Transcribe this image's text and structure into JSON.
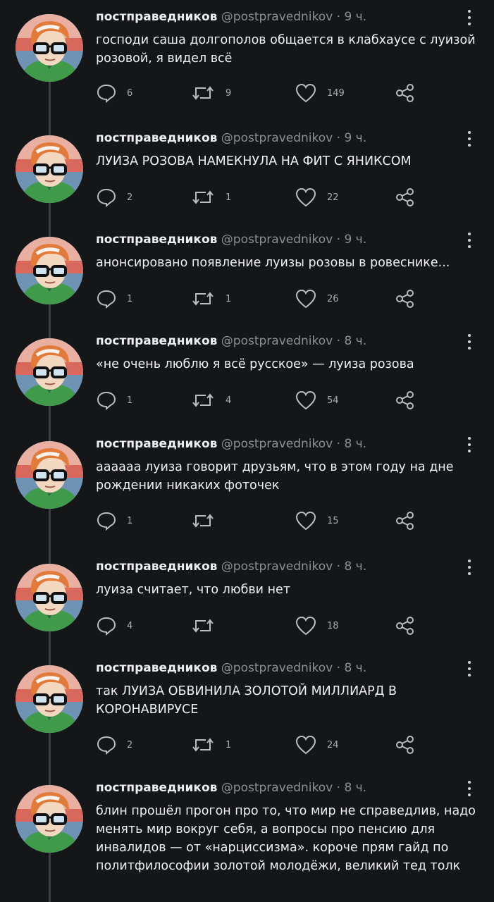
{
  "tweets": [
    {
      "name": "постправедников",
      "handle": "@postpravednikov",
      "time": "9 ч.",
      "text": "господи саша долгополов общается в клабхаусе с луизой розовой, я видел всё",
      "replies": "6",
      "retweets": "9",
      "likes": "149"
    },
    {
      "name": "постправедников",
      "handle": "@postpravednikov",
      "time": "9 ч.",
      "text": "ЛУИЗА РОЗОВА НАМЕКНУЛА НА ФИТ С ЯНИКСОМ",
      "replies": "2",
      "retweets": "1",
      "likes": "22"
    },
    {
      "name": "постправедников",
      "handle": "@postpravednikov",
      "time": "9 ч.",
      "text": "анонсировано появление луизы розовы в ровеснике...",
      "replies": "1",
      "retweets": "1",
      "likes": "26"
    },
    {
      "name": "постправедников",
      "handle": "@postpravednikov",
      "time": "8 ч.",
      "text": "«не очень люблю я всё русское» — луиза розова",
      "replies": "1",
      "retweets": "4",
      "likes": "54"
    },
    {
      "name": "постправедников",
      "handle": "@postpravednikov",
      "time": "8 ч.",
      "text": "аааааа луиза говорит друзьям, что в этом году на дне рождении никаких фоточек",
      "replies": "1",
      "retweets": "",
      "likes": "15"
    },
    {
      "name": "постправедников",
      "handle": "@postpravednikov",
      "time": "8 ч.",
      "text": "луиза считает, что любви нет",
      "replies": "4",
      "retweets": "",
      "likes": "18"
    },
    {
      "name": "постправедников",
      "handle": "@postpravednikov",
      "time": "8 ч.",
      "text": "так ЛУИЗА ОБВИНИЛА ЗОЛОТОЙ МИЛЛИАРД В КОРОНАВИРУСЕ",
      "replies": "2",
      "retweets": "1",
      "likes": "24"
    },
    {
      "name": "постправедников",
      "handle": "@postpravednikov",
      "time": "8 ч.",
      "text": "блин прошёл прогон про то, что мир не справедлив, надо менять мир вокруг себя, а вопросы про пенсию для инвалидов — от «нарциссизма». короче прям гайд по политфилософии золотой молодёжи, великий тед толк",
      "replies": "",
      "retweets": "",
      "likes": ""
    }
  ],
  "icons": {
    "reply": "reply-icon",
    "retweet": "retweet-icon",
    "like": "heart-icon",
    "share": "share-icon",
    "more": "more-vertical-icon"
  },
  "colors": {
    "background": "#151618",
    "text": "#e7e9ea",
    "muted": "#8b9097",
    "icon": "#b8bdc3"
  }
}
